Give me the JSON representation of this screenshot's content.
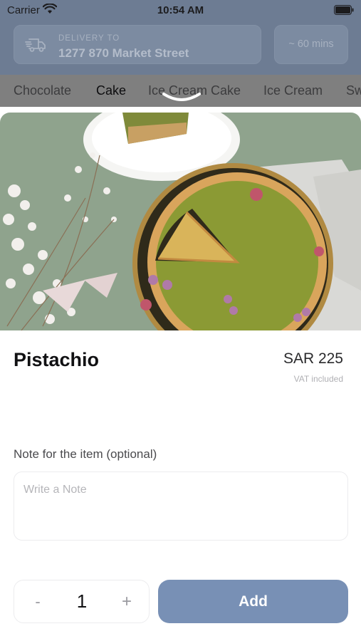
{
  "status_bar": {
    "carrier": "Carrier",
    "time": "10:54 AM"
  },
  "delivery": {
    "label": "DELIVERY TO",
    "address": "1277 870 Market Street",
    "eta": "~ 60 mins"
  },
  "categories": [
    {
      "label": "Chocolate",
      "active": false
    },
    {
      "label": "Cake",
      "active": true
    },
    {
      "label": "Ice Cream Cake",
      "active": false
    },
    {
      "label": "Ice Cream",
      "active": false
    },
    {
      "label": "Sw",
      "active": false
    }
  ],
  "product": {
    "name": "Pistachio",
    "price": "SAR 225",
    "vat_note": "VAT included"
  },
  "note": {
    "label": "Note for the item (optional)",
    "placeholder": "Write a Note"
  },
  "quantity": {
    "minus_label": "-",
    "value": "1",
    "plus_label": "+"
  },
  "actions": {
    "add_label": "Add"
  },
  "colors": {
    "header": "#6d7c93",
    "accent": "#7890b5"
  }
}
